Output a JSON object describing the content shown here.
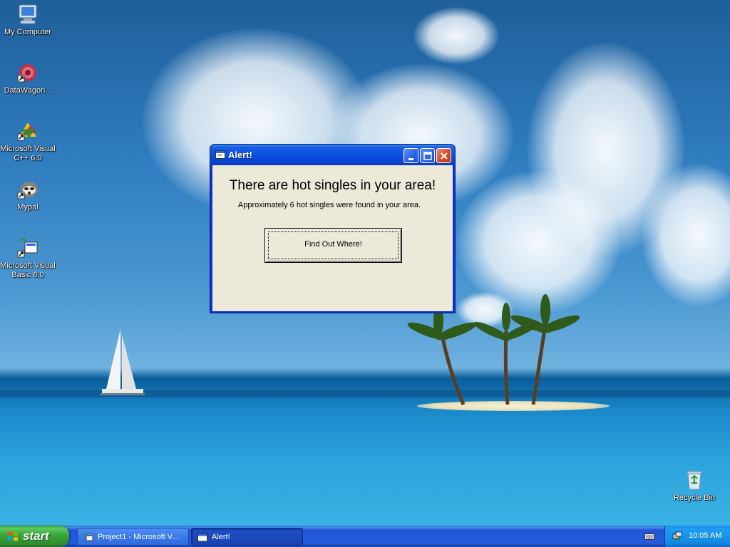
{
  "desktop": {
    "icons": [
      {
        "label": "My Computer"
      },
      {
        "label": "DataWagon..."
      },
      {
        "label": "Microsoft Visual C++ 6.0"
      },
      {
        "label": "Mypal"
      },
      {
        "label": "Microsoft Visual Basic 6.0"
      },
      {
        "label": "Recycle Bin"
      }
    ]
  },
  "window": {
    "title": "Alert!",
    "headline": "There are hot singles in your area!",
    "subtext": "Approximately 6 hot singles were found in your area.",
    "button_label": "Find Out Where!"
  },
  "taskbar": {
    "start_label": "start",
    "tasks": [
      {
        "label": "Project1 - Microsoft V..."
      },
      {
        "label": "Alert!"
      }
    ],
    "clock": "10:05 AM"
  },
  "colors": {
    "titlebar": "#0a4fe0",
    "client": "#ece9d8",
    "taskbar": "#245ddb",
    "start": "#37a537"
  }
}
